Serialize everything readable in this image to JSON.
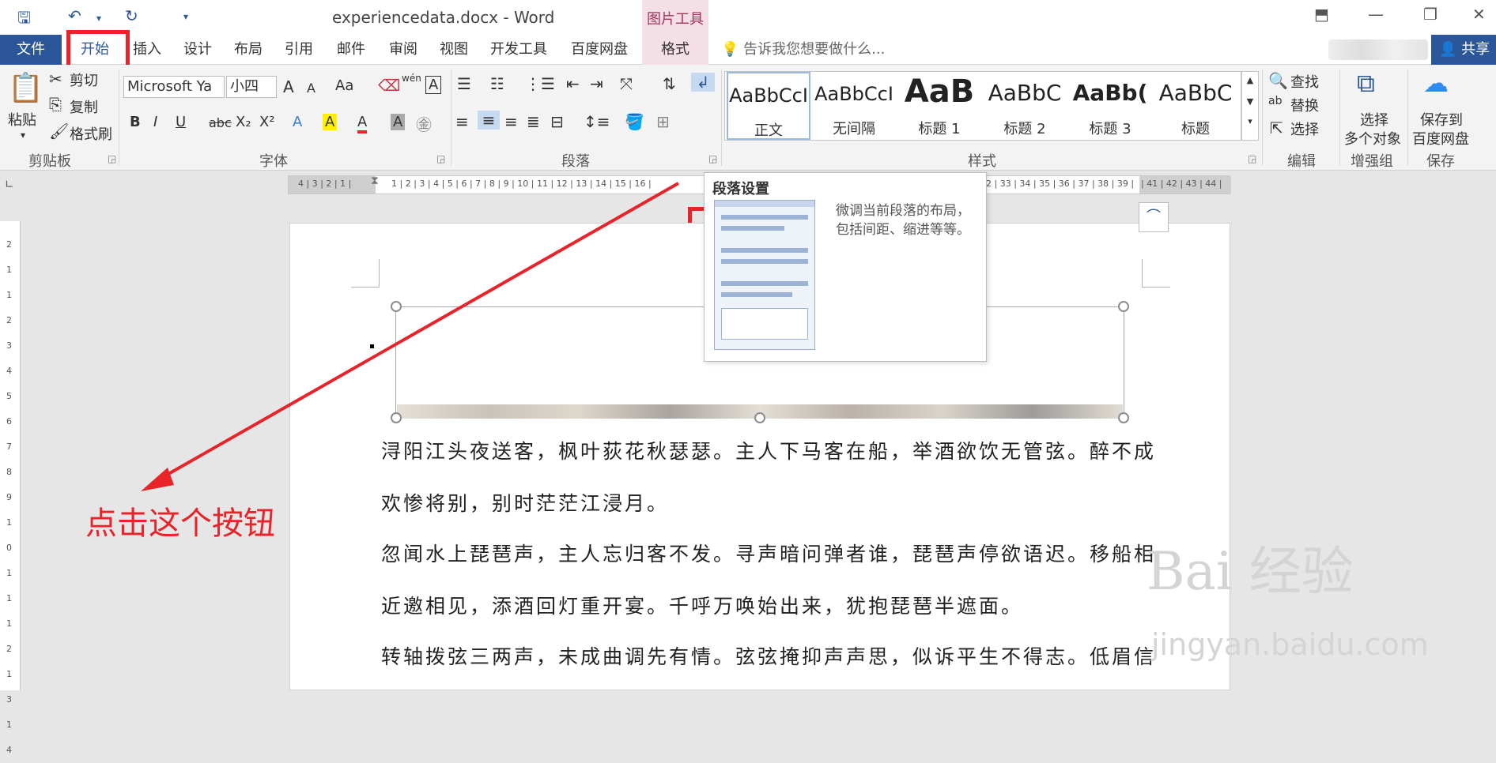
{
  "window": {
    "title": "experiencedata.docx - Word",
    "context_tab_title": "图片工具",
    "qat": {
      "save_icon": "save-icon",
      "undo_icon": "undo-icon",
      "redo_icon": "redo-icon",
      "customize": "▾"
    },
    "controls": {
      "ribbon_display": "⬒",
      "minimize": "—",
      "restore": "❐",
      "close": "✕"
    }
  },
  "tabs": [
    {
      "label": "文件"
    },
    {
      "label": "开始"
    },
    {
      "label": "插入"
    },
    {
      "label": "设计"
    },
    {
      "label": "布局"
    },
    {
      "label": "引用"
    },
    {
      "label": "邮件"
    },
    {
      "label": "审阅"
    },
    {
      "label": "视图"
    },
    {
      "label": "开发工具"
    },
    {
      "label": "百度网盘"
    },
    {
      "label": "格式"
    }
  ],
  "tell_me": "告诉我您想要做什么...",
  "share": "共享",
  "ribbon": {
    "clipboard": {
      "paste": "粘贴",
      "cut": "剪切",
      "copy": "复制",
      "format_painter": "格式刷",
      "label": "剪贴板"
    },
    "font": {
      "font_name": "Microsoft Ya",
      "font_size": "小四",
      "label": "字体",
      "buttons": [
        "B",
        "I",
        "U",
        "abc",
        "X₂",
        "X²",
        "A",
        "A",
        "A",
        "A"
      ],
      "grow": "A",
      "shrink": "A",
      "change_case": "Aa",
      "phonetic": "wén",
      "border_char": "A"
    },
    "paragraph": {
      "label": "段落"
    },
    "styles": {
      "label": "样式",
      "items": [
        {
          "sample": "AaBbCcI",
          "name": "正文"
        },
        {
          "sample": "AaBbCcI",
          "name": "无间隔"
        },
        {
          "sample": "AaB",
          "name": "标题 1"
        },
        {
          "sample": "AaBbC",
          "name": "标题 2"
        },
        {
          "sample": "AaBb(",
          "name": "标题 3"
        },
        {
          "sample": "AaBbC",
          "name": "标题"
        }
      ]
    },
    "editing": {
      "find": "查找",
      "replace": "替换",
      "select": "选择",
      "label": "编辑"
    },
    "addins": {
      "select_multi_1": "选择",
      "select_multi_2": "多个对象",
      "label": "增强组"
    },
    "save": {
      "save_to_1": "保存到",
      "save_to_2": "百度网盘",
      "label": "保存"
    }
  },
  "ruler_left": "4 | 3 | 2 | 1 |",
  "ruler_right": "2 | 33 | 34 | 35 | 36 | 37 | 38 | 39 |",
  "ruler_right2": "| 41 | 42 | 43 | 44 |",
  "ruler_mid": "1 | 2 | 3 | 4 | 5 | 6 | 7 | 8 | 9 | 10 | 11 | 12 | 13 | 14 | 15 | 16 |",
  "ruler_v": "2 1 1 2 3 4 5 6 7 8 9 10 11 12 13 14",
  "tooltip": {
    "title": "段落设置",
    "description": "微调当前段落的布局，包括间距、缩进等等。"
  },
  "document": {
    "lines": [
      "浔阳江头夜送客，枫叶荻花秋瑟瑟。主人下马客在船，举酒欲饮无管弦。醉不成",
      "欢惨将别，别时茫茫江浸月。",
      "忽闻水上琵琶声，主人忘归客不发。寻声暗问弹者谁，琵琶声停欲语迟。移船相",
      "近邀相见，添酒回灯重开宴。千呼万唤始出来，犹抱琵琶半遮面。",
      "转轴拨弦三两声，未成曲调先有情。弦弦掩抑声声思，似诉平生不得志。低眉信"
    ]
  },
  "annotation": "点击这个按钮",
  "watermark": {
    "brand": "Bai 经验",
    "url": "jingyan.baidu.com"
  },
  "colors": {
    "accent": "#2b579a",
    "annotation_red": "#e8232a",
    "context_tab": "#f5dfe7"
  }
}
